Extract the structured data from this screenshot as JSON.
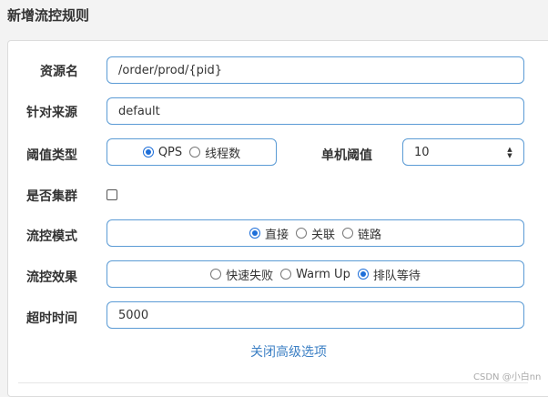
{
  "dialog": {
    "title": "新增流控规则"
  },
  "resource": {
    "label": "资源名",
    "value": "/order/prod/{pid}"
  },
  "source": {
    "label": "针对来源",
    "value": "default"
  },
  "threshold_type": {
    "label": "阈值类型",
    "options": [
      {
        "label": "QPS",
        "checked": true
      },
      {
        "label": "线程数",
        "checked": false
      }
    ]
  },
  "single_threshold": {
    "label": "单机阈值",
    "value": "10"
  },
  "cluster": {
    "label": "是否集群",
    "checked": false
  },
  "flow_mode": {
    "label": "流控模式",
    "options": [
      {
        "label": "直接",
        "checked": true
      },
      {
        "label": "关联",
        "checked": false
      },
      {
        "label": "链路",
        "checked": false
      }
    ]
  },
  "flow_effect": {
    "label": "流控效果",
    "options": [
      {
        "label": "快速失败",
        "checked": false
      },
      {
        "label": "Warm Up",
        "checked": false
      },
      {
        "label": "排队等待",
        "checked": true
      }
    ]
  },
  "timeout": {
    "label": "超时时间",
    "value": "5000"
  },
  "advanced": {
    "toggle_label": "关闭高级选项"
  },
  "watermark": "CSDN @小白nn",
  "colors": {
    "accent": "#1e6fd9",
    "border": "#5b9bd5",
    "link": "#3b7fc4"
  }
}
